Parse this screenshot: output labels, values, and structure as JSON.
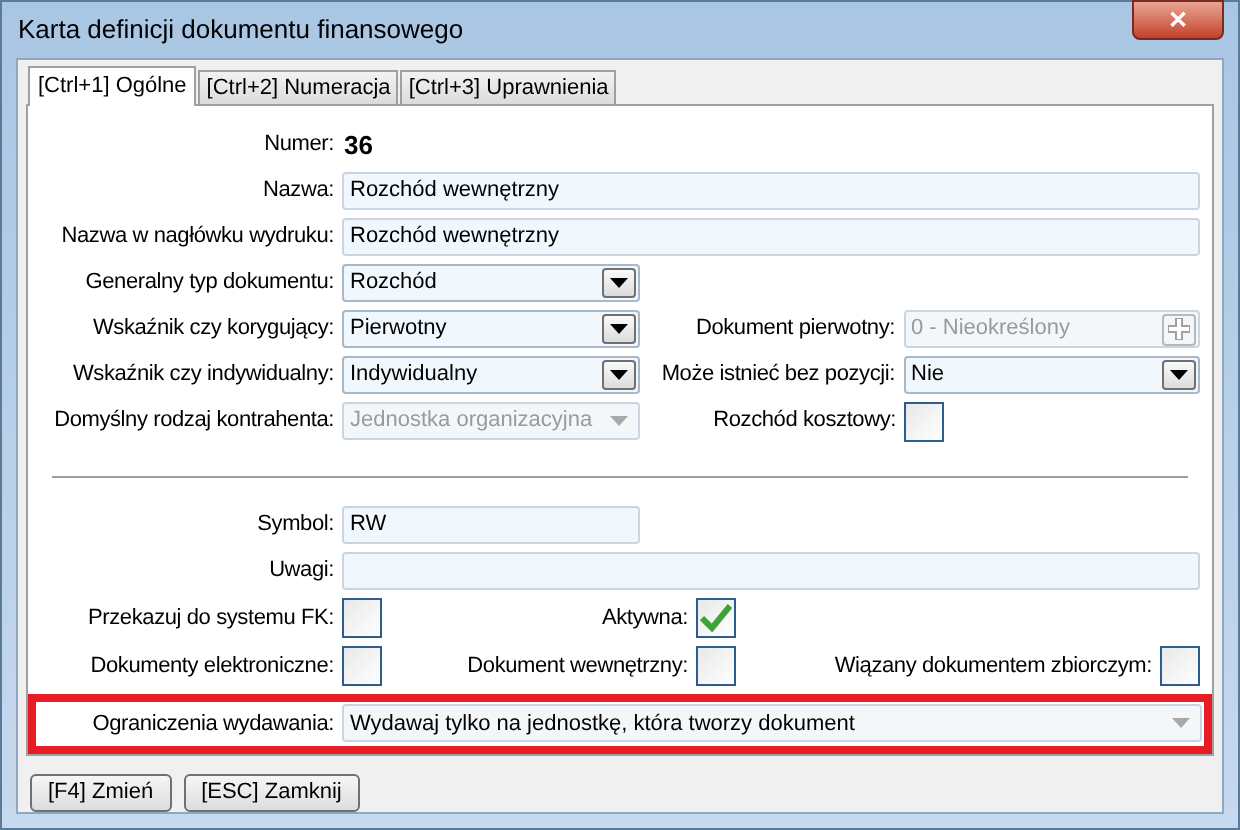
{
  "window": {
    "title": "Karta definicji dokumentu finansowego",
    "close": "✕"
  },
  "tabs": [
    {
      "label": "[Ctrl+1] Ogólne",
      "selected": true
    },
    {
      "label": "[Ctrl+2] Numeracja",
      "selected": false
    },
    {
      "label": "[Ctrl+3] Uprawnienia",
      "selected": false
    }
  ],
  "rows": [
    {
      "kind": "value",
      "label": "Numer:",
      "value": "36"
    },
    {
      "kind": "text",
      "label": "Nazwa:",
      "value": "Rozchód wewnętrzny"
    },
    {
      "kind": "text",
      "label": "Nazwa w nagłówku wydruku:",
      "value": "Rozchód wewnętrzny"
    },
    {
      "kind": "select",
      "label": "Generalny typ dokumentu:",
      "value": "Rozchód",
      "disabled": false
    },
    {
      "kind": "select",
      "label": "Wskaźnik czy korygujący:",
      "value": "Pierwotny",
      "disabled": false,
      "right": {
        "kind": "lookup",
        "label": "Dokument pierwotny:",
        "value": "0 - Nieokreślony",
        "disabled": true
      }
    },
    {
      "kind": "select",
      "label": "Wskaźnik czy indywidualny:",
      "value": "Indywidualny",
      "disabled": false,
      "right": {
        "kind": "select",
        "label": "Może istnieć bez pozycji:",
        "value": "Nie",
        "disabled": false
      }
    },
    {
      "kind": "select",
      "label": "Domyślny rodzaj kontrahenta:",
      "value": "Jednostka organizacyjna",
      "disabled": true,
      "right": {
        "kind": "checkbox",
        "label": "Rozchód kosztowy:",
        "checked": false
      }
    },
    {
      "kind": "separator"
    },
    {
      "kind": "short_text",
      "label": "Symbol:",
      "value": "RW"
    },
    {
      "kind": "text",
      "label": "Uwagi:"
    },
    {
      "kind": "checks",
      "items": [
        {
          "label": "Przekazuj do systemu FK:",
          "checked": false
        },
        {
          "label": "Aktywna:",
          "checked": true
        }
      ]
    },
    {
      "kind": "checks",
      "items": [
        {
          "label": "Dokumenty elektroniczne:",
          "checked": false
        },
        {
          "label": "Dokument wewnętrzny:",
          "checked": false
        },
        {
          "label": "Wiązany dokumentem zbiorczym:",
          "checked": false
        }
      ]
    },
    {
      "kind": "wide_select",
      "label": "Ograniczenia wydawania:",
      "value": "Wydawaj tylko na jednostkę, która tworzy dokument",
      "disabled": true,
      "highlighted": true
    }
  ],
  "buttons": [
    "[F4] Zmień",
    "[ESC] Zamknij"
  ]
}
